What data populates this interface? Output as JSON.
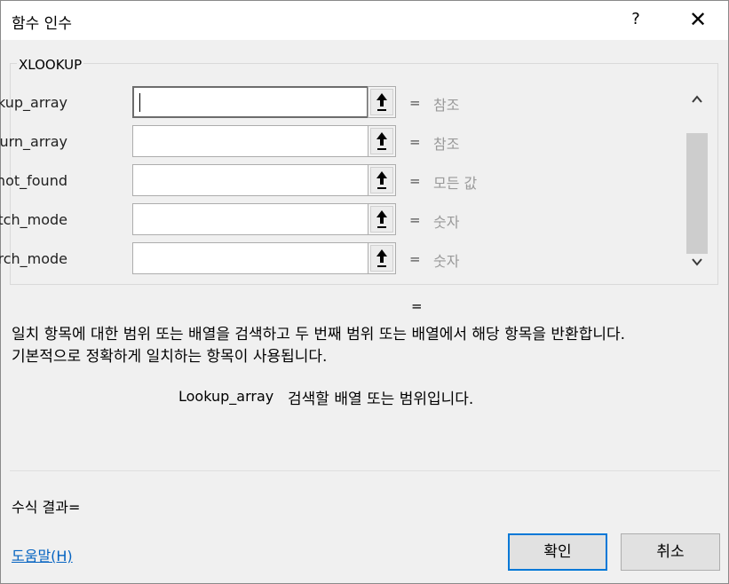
{
  "window": {
    "title": "함수 인수",
    "help_label": "?",
    "close_label": "✕"
  },
  "function_name": "XLOOKUP",
  "arguments": [
    {
      "label": "Lookup_array",
      "value": "",
      "hint": "참조"
    },
    {
      "label": "Return_array",
      "value": "",
      "hint": "참조"
    },
    {
      "label": "If_not_found",
      "value": "",
      "hint": "모든 값"
    },
    {
      "label": "Match_mode",
      "value": "",
      "hint": "숫자"
    },
    {
      "label": "Search_mode",
      "value": "",
      "hint": "숫자"
    }
  ],
  "equals_sign": "=",
  "function_result": "=",
  "description": {
    "line1": "일치 항목에 대한 범위 또는 배열을 검색하고 두 번째 범위 또는 배열에서 해당 항목을 반환합니다.",
    "line2": "기본적으로 정확하게 일치하는 항목이 사용됩니다."
  },
  "argument_help": {
    "name": "Lookup_array",
    "text": "검색할 배열 또는 범위입니다."
  },
  "formula_result_label": "수식 결과=",
  "help_link_label": "도움말(H)",
  "buttons": {
    "ok_label": "확인",
    "cancel_label": "취소"
  },
  "icons": {
    "refedit": "collapse-dialog-arrow-icon",
    "scroll_up": "chevron-up-icon",
    "scroll_down": "chevron-down-icon"
  }
}
